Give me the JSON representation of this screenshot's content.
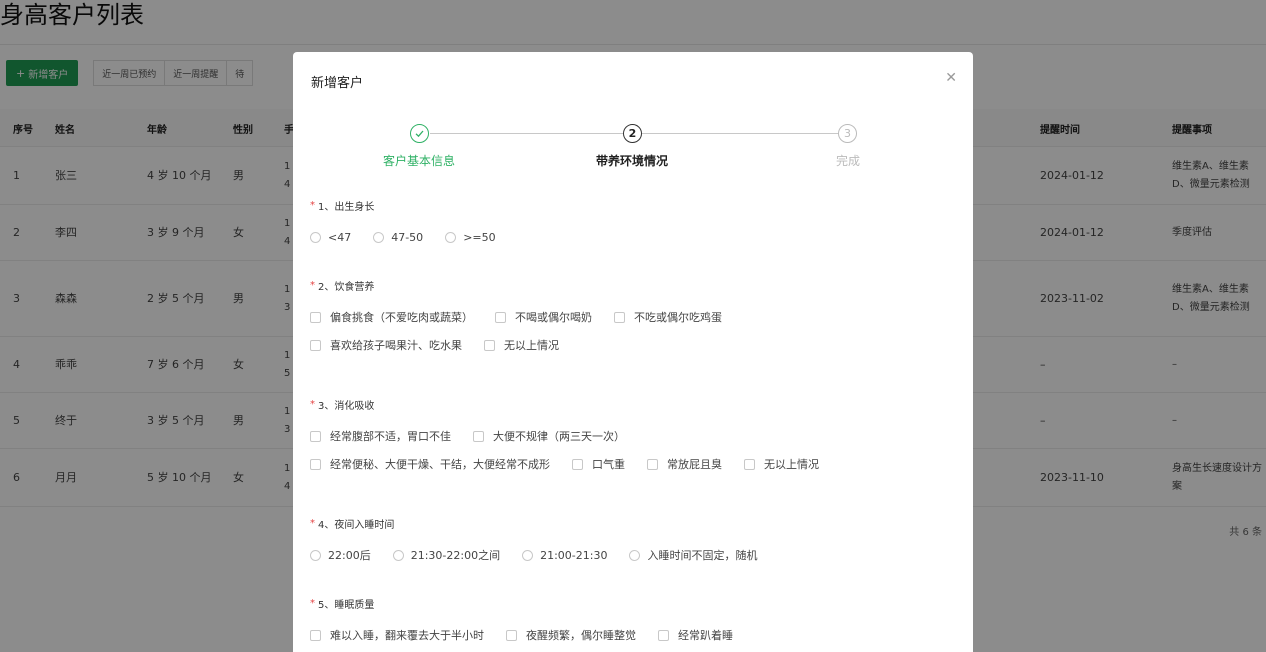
{
  "page": {
    "title": "身高客户列表",
    "add_button": "新增客户",
    "filters": [
      "近一周已预约",
      "近一周提醒",
      "待"
    ],
    "columns": [
      "序号",
      "姓名",
      "年龄",
      "性别",
      "手",
      "提醒时间",
      "提醒事项"
    ],
    "rows": [
      {
        "no": "1",
        "name": "张三",
        "age": "4 岁 10 个月",
        "gender": "男",
        "phone": "1\n4",
        "remind_time": "2024-01-12",
        "remind_item": "维生素A、维生素D、微量元素检测"
      },
      {
        "no": "2",
        "name": "李四",
        "age": "3 岁 9 个月",
        "gender": "女",
        "phone": "1\n4",
        "remind_time": "2024-01-12",
        "remind_item": "季度评估"
      },
      {
        "no": "3",
        "name": "森森",
        "age": "2 岁 5 个月",
        "gender": "男",
        "phone": "1\n3",
        "remind_time": "2023-11-02",
        "remind_item": "维生素A、维生素D、微量元素检测"
      },
      {
        "no": "4",
        "name": "乖乖",
        "age": "7 岁 6 个月",
        "gender": "女",
        "phone": "1\n5",
        "remind_time": "–",
        "remind_item": "–"
      },
      {
        "no": "5",
        "name": "终于",
        "age": "3 岁 5 个月",
        "gender": "男",
        "phone": "1\n3",
        "remind_time": "–",
        "remind_item": "–"
      },
      {
        "no": "6",
        "name": "月月",
        "age": "5 岁 10 个月",
        "gender": "女",
        "phone": "1\n4",
        "remind_time": "2023-11-10",
        "remind_item": "身高生长速度设计方案"
      }
    ],
    "total": "共 6 条"
  },
  "dialog": {
    "title": "新增客户",
    "close_icon": "close-icon",
    "steps": [
      {
        "number": "",
        "label": "客户基本信息",
        "status": "done"
      },
      {
        "number": "2",
        "label": "带养环境情况",
        "status": "active"
      },
      {
        "number": "3",
        "label": "完成",
        "status": "wait"
      }
    ],
    "questions": [
      {
        "title": "1、出生身长",
        "type": "radio",
        "rows": [
          [
            "<47",
            "47-50",
            ">=50"
          ]
        ]
      },
      {
        "title": "2、饮食营养",
        "type": "checkbox",
        "rows": [
          [
            "偏食挑食（不爱吃肉或蔬菜）",
            "不喝或偶尔喝奶",
            "不吃或偶尔吃鸡蛋"
          ],
          [
            "喜欢给孩子喝果汁、吃水果",
            "无以上情况"
          ]
        ]
      },
      {
        "title": "3、消化吸收",
        "type": "checkbox",
        "rows": [
          [
            "经常腹部不适，胃口不佳",
            "大便不规律（两三天一次）"
          ],
          [
            "经常便秘、大便干燥、干结，大便经常不成形",
            "口气重",
            "常放屁且臭",
            "无以上情况"
          ]
        ]
      },
      {
        "title": "4、夜间入睡时间",
        "type": "radio",
        "rows": [
          [
            "22:00后",
            "21:30-22:00之间",
            "21:00-21:30",
            "入睡时间不固定，随机"
          ]
        ]
      },
      {
        "title": "5、睡眠质量",
        "type": "checkbox",
        "rows": [
          [
            "难以入睡，翻来覆去大于半小时",
            "夜醒频繁，偶尔睡整觉",
            "经常趴着睡"
          ]
        ]
      }
    ]
  },
  "colors": {
    "primary": "#2fb165",
    "required": "#e54545",
    "mask": "rgba(0,0,0,0.45)"
  }
}
